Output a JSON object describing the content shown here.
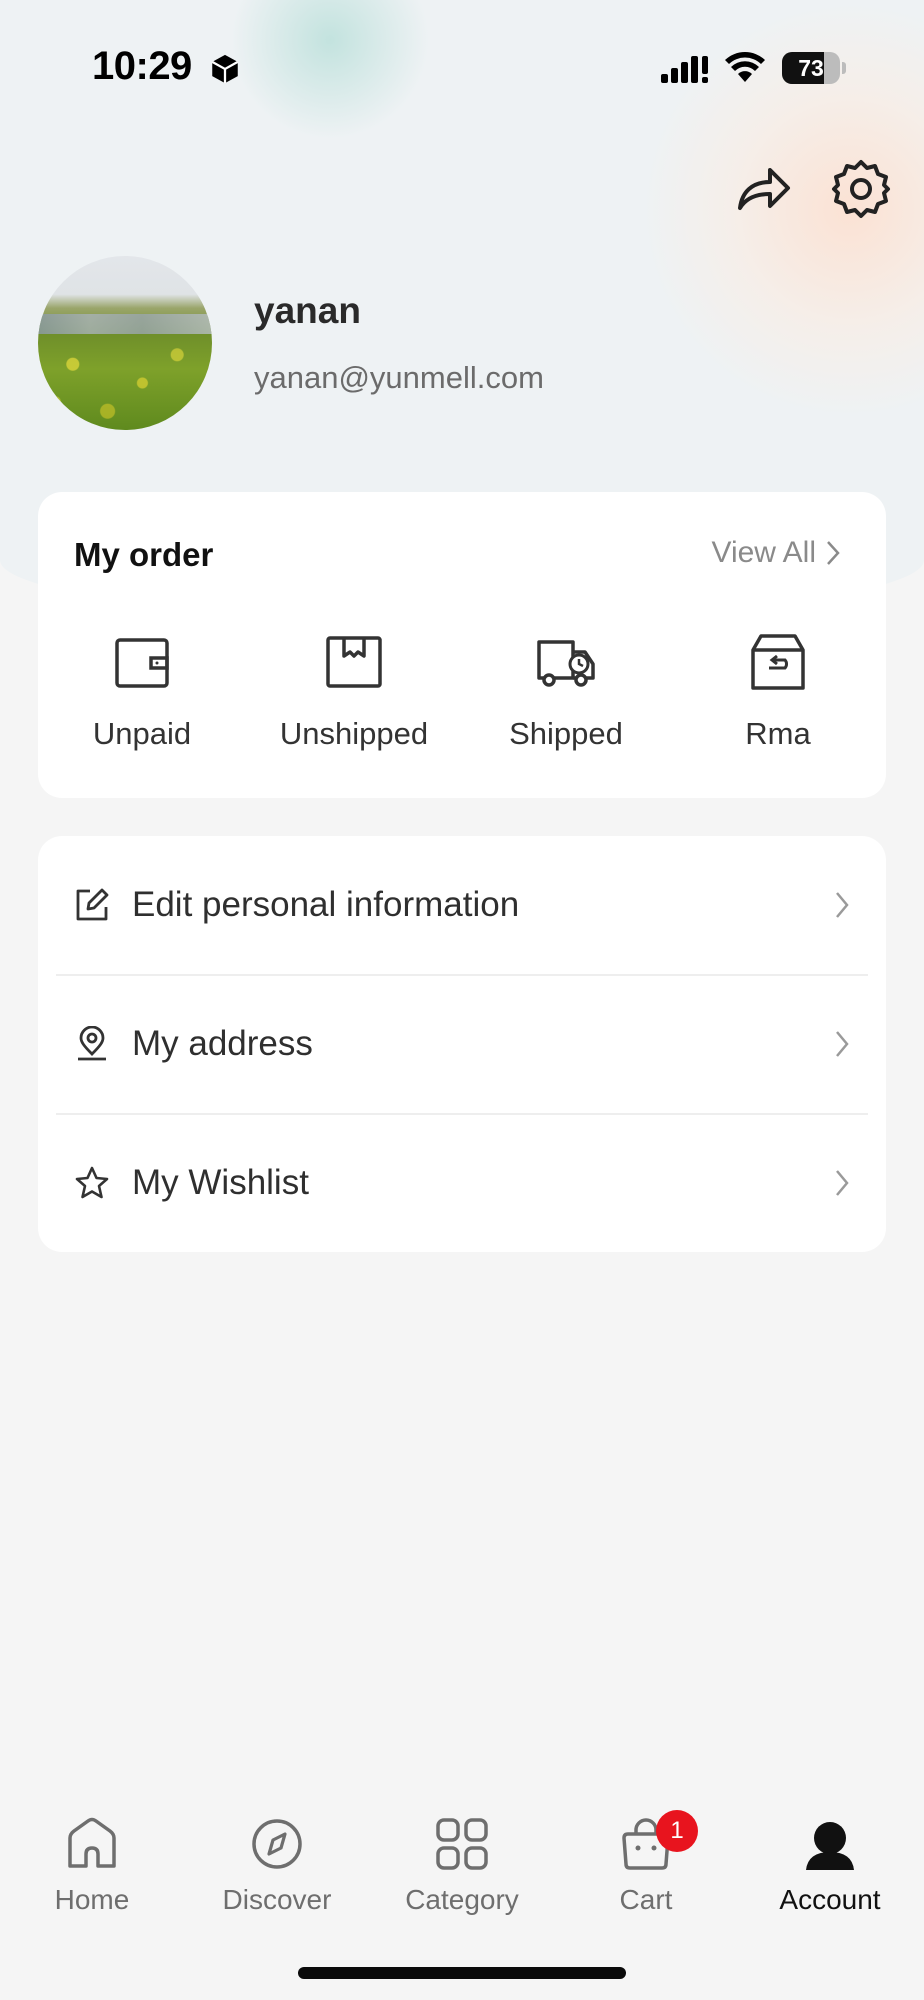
{
  "status_bar": {
    "time": "10:29",
    "battery_level": "73",
    "battery_fraction": 0.73
  },
  "header": {
    "share_icon": "share-forward-icon",
    "settings_icon": "gear-icon"
  },
  "profile": {
    "name": "yanan",
    "email": "yanan@yunmell.com"
  },
  "order": {
    "title": "My order",
    "view_all": "View All",
    "items": [
      {
        "label": "Unpaid",
        "icon": "wallet-icon"
      },
      {
        "label": "Unshipped",
        "icon": "box-icon"
      },
      {
        "label": "Shipped",
        "icon": "truck-icon"
      },
      {
        "label": "Rma",
        "icon": "return-box-icon"
      }
    ]
  },
  "menu": {
    "items": [
      {
        "label": "Edit personal information",
        "icon": "edit-icon"
      },
      {
        "label": "My address",
        "icon": "location-icon"
      },
      {
        "label": "My Wishlist",
        "icon": "star-icon"
      }
    ]
  },
  "bottom_nav": {
    "items": [
      {
        "label": "Home",
        "icon": "home-icon"
      },
      {
        "label": "Discover",
        "icon": "compass-icon"
      },
      {
        "label": "Category",
        "icon": "grid-icon"
      },
      {
        "label": "Cart",
        "icon": "cart-icon",
        "badge": "1"
      },
      {
        "label": "Account",
        "icon": "account-icon",
        "active": true
      }
    ]
  },
  "colors": {
    "background": "#f5f5f5",
    "card": "#ffffff",
    "badge": "#e8141e",
    "text_primary": "#111111",
    "text_secondary": "#6e6e6e"
  }
}
